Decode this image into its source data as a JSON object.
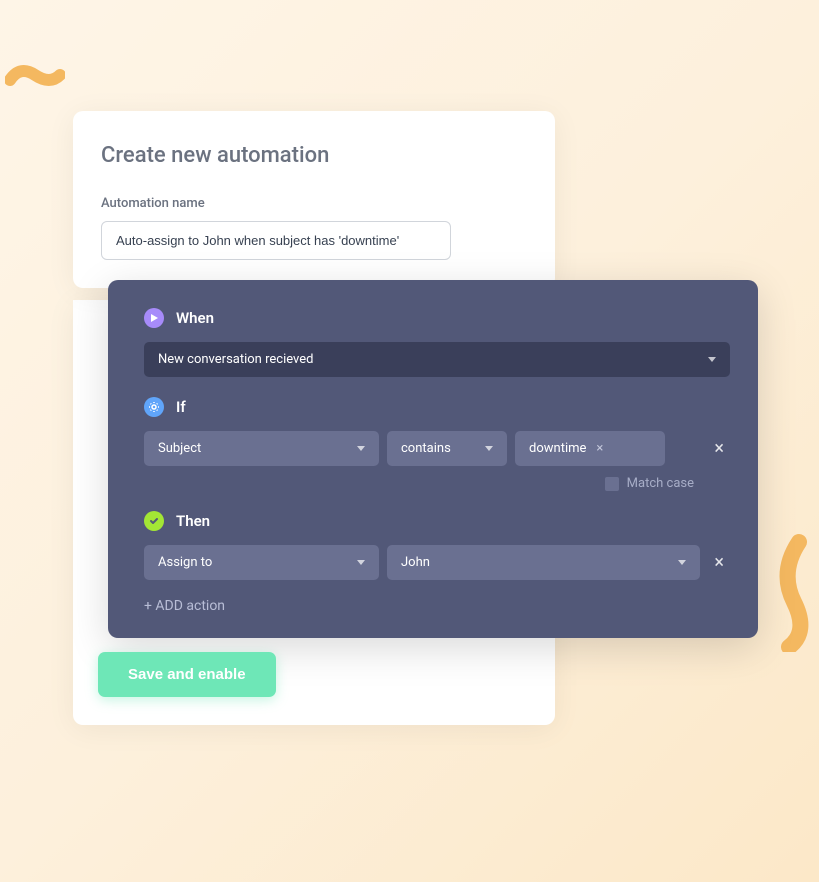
{
  "page": {
    "title": "Create new automation"
  },
  "form": {
    "name_label": "Automation name",
    "name_value": "Auto-assign to John when subject has 'downtime'"
  },
  "rules": {
    "when": {
      "title": "When",
      "trigger": "New conversation recieved"
    },
    "if": {
      "title": "If",
      "field": "Subject",
      "operator": "contains",
      "value": "downtime",
      "match_case_label": "Match case"
    },
    "then": {
      "title": "Then",
      "action": "Assign to",
      "target": "John"
    },
    "add_action_label": "+ ADD action"
  },
  "buttons": {
    "save": "Save and enable"
  }
}
